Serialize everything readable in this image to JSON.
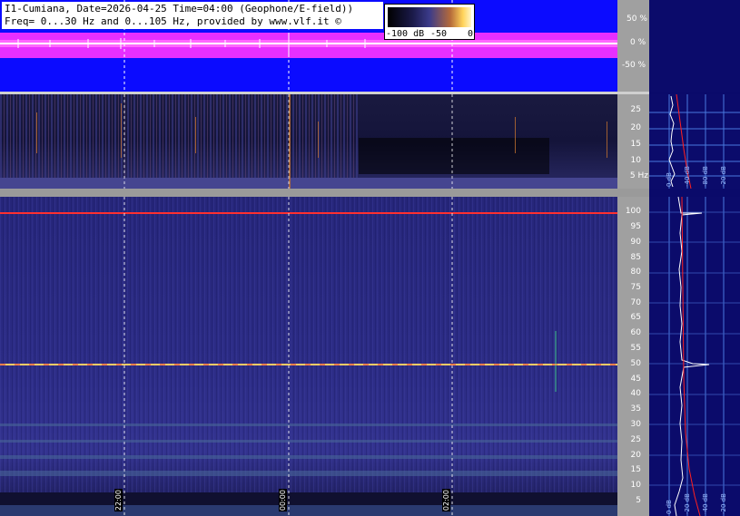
{
  "header": {
    "line1": "I1-Cumiana, Date=2026-04-25 Time=04:00 (Geophone/E-field))",
    "line2": "Freq= 0...30 Hz and 0...105 Hz, provided by www.vlf.it ©"
  },
  "scale": {
    "min_label": "-100 dB",
    "mid_label": "-50",
    "max_label": "0"
  },
  "percent_axis": [
    "50 %",
    "0 %",
    "-50 %"
  ],
  "lf_axis": [
    "25",
    "20",
    "15",
    "10",
    "5 Hz"
  ],
  "hf_axis": [
    "100",
    "95",
    "90",
    "85",
    "80",
    "75",
    "70",
    "65",
    "60",
    "55",
    "50",
    "45",
    "40",
    "35",
    "30",
    "25",
    "20",
    "15",
    "10",
    "5"
  ],
  "time_labels": [
    "22:00",
    "00:00",
    "02:00"
  ],
  "lf_db_labels": [
    "0 dB",
    "-40 dB",
    "-80 dB",
    "-20 dB"
  ],
  "hf_db_labels": [
    "0 dB",
    "-20 dB",
    "-40 dB",
    "-20 dB"
  ],
  "colors": {
    "waveform_bg": "#0b0bff",
    "waveform_trace": "#ff33ff",
    "spectrum_line": "#ffffff",
    "fit_line": "#ff2020",
    "axis_bg": "#a0a0a0"
  }
}
